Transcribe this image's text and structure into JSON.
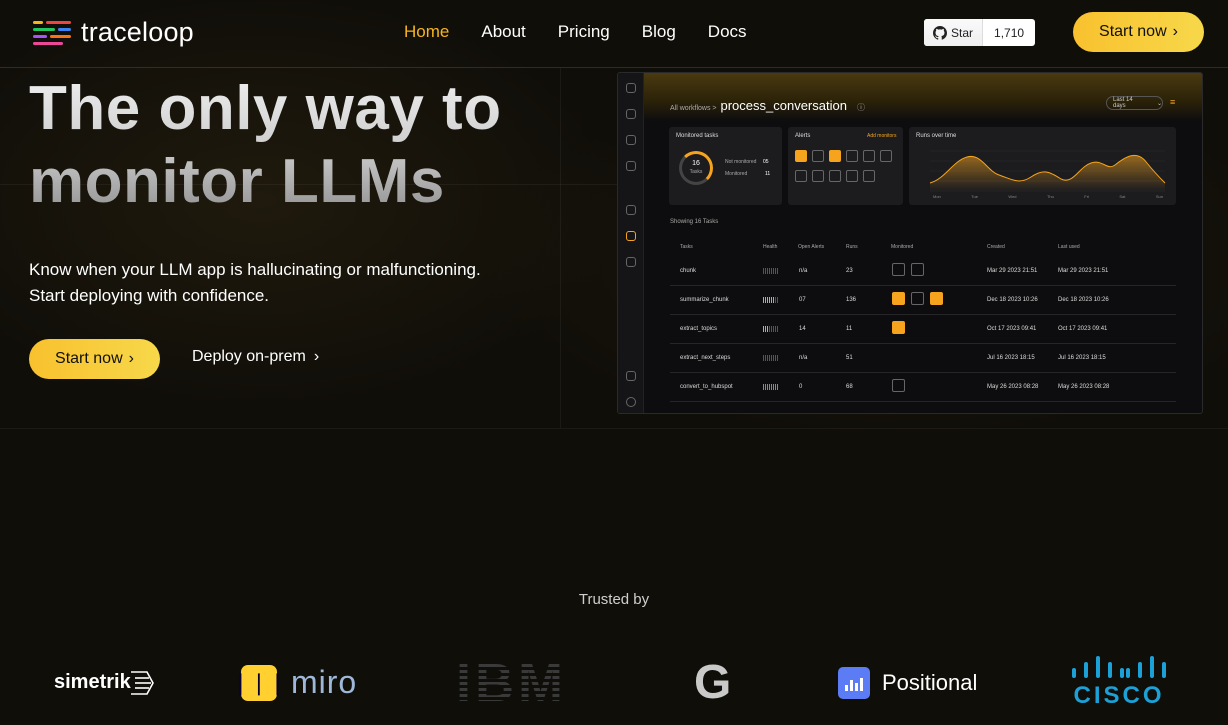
{
  "brand": {
    "name": "traceloop"
  },
  "nav": {
    "items": [
      "Home",
      "About",
      "Pricing",
      "Blog",
      "Docs"
    ],
    "active": "Home"
  },
  "github": {
    "star_label": "Star",
    "count": "1,710"
  },
  "header": {
    "cta": "Start now"
  },
  "hero": {
    "title_line1": "The only way to",
    "title_line2": "monitor LLMs",
    "sub_line1": "Know when your LLM app is hallucinating or malfunctioning.",
    "sub_line2": "Start deploying with confidence.",
    "cta_primary": "Start now",
    "cta_secondary": "Deploy on-prem"
  },
  "dashboard": {
    "breadcrumb_prefix": "All workflows >",
    "workflow": "process_conversation",
    "range": "Last 14 days",
    "monitored_tasks": {
      "title": "Monitored tasks",
      "total": "16",
      "total_label": "Tasks",
      "not_monitored_label": "Not monitored",
      "not_monitored": "05",
      "monitored_label": "Monitored",
      "monitored": "11"
    },
    "alerts": {
      "title": "Alerts",
      "add": "Add monitors"
    },
    "runs": {
      "title": "Runs over time",
      "x_labels": [
        "Mon",
        "Tue",
        "Wed",
        "Thu",
        "Fri",
        "Sat",
        "Sun"
      ]
    },
    "showing": "Showing 16 Tasks",
    "columns": [
      "Tasks",
      "Health",
      "Open Alerts",
      "Runs",
      "Monitored",
      "Created",
      "Last used"
    ],
    "rows": [
      {
        "task": "chunk",
        "alerts": "n/a",
        "runs": "23",
        "created": "Mar 29 2023 21:51",
        "last": "Mar 29 2023 21:51"
      },
      {
        "task": "summarize_chunk",
        "alerts": "07",
        "runs": "136",
        "created": "Dec 18 2023 10:26",
        "last": "Dec 18 2023 10:26"
      },
      {
        "task": "extract_topics",
        "alerts": "14",
        "runs": "11",
        "created": "Oct 17 2023 09:41",
        "last": "Oct 17 2023 09:41"
      },
      {
        "task": "extract_next_steps",
        "alerts": "n/a",
        "runs": "51",
        "created": "Jul 16 2023 18:15",
        "last": "Jul 16 2023 18:15"
      },
      {
        "task": "convert_to_hubspot",
        "alerts": "0",
        "runs": "68",
        "created": "May 26 2023 08:28",
        "last": "May 26 2023 08:28"
      }
    ]
  },
  "trusted": {
    "label": "Trusted by",
    "logos": [
      "simetrik",
      "miro",
      "IBM",
      "G",
      "Positional",
      "CISCO"
    ]
  },
  "colors": {
    "accent": "#f6b51f",
    "background": "#100e09"
  }
}
